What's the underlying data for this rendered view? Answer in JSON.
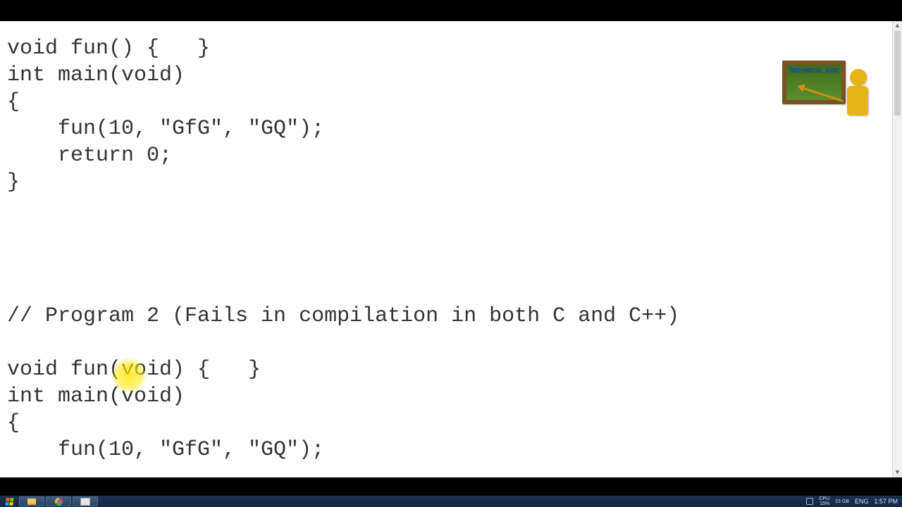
{
  "code_lines": [
    "void fun() {   }",
    "int main(void)",
    "{",
    "    fun(10, \"GfG\", \"GQ\");",
    "    return 0;",
    "}",
    "",
    "",
    "",
    "",
    "// Program 2 (Fails in compilation in both C and C++)",
    "",
    "void fun(void) {   }",
    "int main(void)",
    "{",
    "    fun(10, \"GfG\", \"GQ\");"
  ],
  "logo": {
    "label": "TECHNICAL GOD"
  },
  "taskbar": {
    "tray": {
      "cpu_label": "CPU",
      "cpu_value": "15%",
      "mem_label": "23 GB",
      "lang": "ENG",
      "time": "1:57 PM"
    }
  }
}
